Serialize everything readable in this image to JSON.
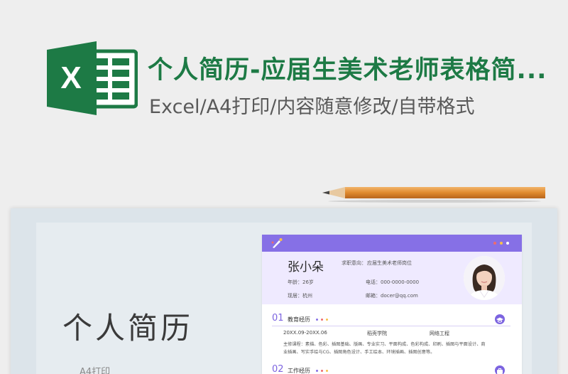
{
  "header": {
    "title": "个人简历-应届生美术老师表格简...",
    "subtitle": "Excel/A4打印/内容随意修改/自带格式",
    "logo_letter": "X",
    "logo_icon": "excel-icon"
  },
  "cover": {
    "title": "个人简历",
    "subtitle": "A4打印"
  },
  "resume": {
    "name": "张小朵",
    "intent_label": "求职意向：",
    "intent_value": "应届生美术老师岗位",
    "age": "年龄：26岁",
    "phone": "电话：000-0000-0000",
    "residence": "现居：杭州",
    "email": "邮箱：docer@qq.com",
    "sections": [
      {
        "number": "01",
        "label": "教育经历",
        "icon": "graduation-icon",
        "date": "20XX.09-20XX.06",
        "school": "稻壳学院",
        "major": "网络工程",
        "courses_line1": "主修课程：素描、色彩、插图基础、版画、专业实习、平面构成、色彩构成、印刷、插图与平面设计、商",
        "courses_line2": "业插画、写实手绘与CG、插图角色设计、手工绘本、环境插画、插图创意等。"
      },
      {
        "number": "02",
        "label": "工作经历",
        "icon": "briefcase-icon"
      }
    ]
  },
  "colors": {
    "brand_green": "#1d7a45",
    "accent_purple": "#8670e6",
    "dot_red": "#f06b6b",
    "dot_yellow": "#f7c04a",
    "dot_purple": "#8670e6"
  }
}
